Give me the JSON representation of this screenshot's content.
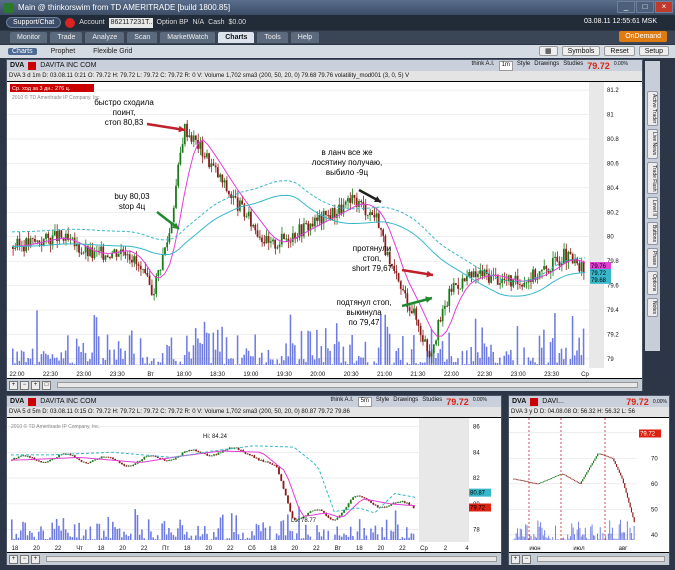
{
  "window": {
    "title": "Main @ thinkorswim from TD AMERITRADE [build 1800.85]"
  },
  "account": {
    "support_label": "Support/Chat",
    "account_label": "Account",
    "account_value": "862117231T...",
    "option_bp_label": "Option BP",
    "option_bp_value": "N/A",
    "cash_label": "Cash",
    "cash_value": "$0.00",
    "datetime": "03.08.11 12:55:61 MSK"
  },
  "tabs": [
    "Monitor",
    "Trade",
    "Analyze",
    "Scan",
    "MarketWatch",
    "Charts",
    "Tools",
    "Help"
  ],
  "active_tab": "Charts",
  "ondemand": "OnDemand",
  "subtabs": [
    "Charts",
    "Prophet",
    "Flexible Grid"
  ],
  "toolbar": {
    "symbols": "Symbols",
    "reset": "Reset",
    "setup": "Setup"
  },
  "main_chart": {
    "symbol": "DVA",
    "company": "DAVITA INC COM",
    "think": "think A.I.",
    "period": "1m",
    "style": "Style",
    "drawings": "Drawings",
    "studies": "Studies",
    "last": "79.72",
    "pct": "0.00%",
    "quote": "DVA 3 d 1m  D: 03.08.11 0:21  O: 79.72  H: 79.72  L: 79.72  C: 79.72  R: 0  V:  Volume 1,702  sma3 (200, 50, 20, 0)  79.68  79.76  volatility_mod001 (3, 0, 5)  V",
    "note_red": "Ср. ход за 3 дн.: 276 ц.",
    "copyright": "2010 © TD Ameritrade IP Company, Inc.",
    "y_ticks": [
      "81.2",
      "81",
      "80.8",
      "80.6",
      "80.4",
      "80.2",
      "80",
      "79.8",
      "79.6",
      "79.4",
      "79.2",
      "79"
    ],
    "x_ticks": [
      "22:00",
      "22:30",
      "23:00",
      "23:30",
      "Вт",
      "18:00",
      "18:30",
      "19:00",
      "19:30",
      "20:00",
      "20:30",
      "21:00",
      "21:30",
      "22:00",
      "22:30",
      "23:00",
      "23:30",
      "Ср"
    ],
    "price_labels": [
      "79.76",
      "79.72",
      "79.68"
    ],
    "annotations": {
      "a1": [
        "быстро сходила",
        "поинт,",
        "стоп 80,83"
      ],
      "a2": [
        "buy 80,03",
        "stop 4ц"
      ],
      "a3": [
        "в ланч все же",
        "лосятину получаю,",
        "выбило -9ц"
      ],
      "a4": [
        "протянули",
        "стоп,",
        "short 79,67"
      ],
      "a5": [
        "подтянул стоп,",
        "выкинула",
        "по 79,47"
      ]
    }
  },
  "side_tabs": [
    "Active Trader",
    "Live News",
    "Trade Flash",
    "Level II",
    "Buttons",
    "Phase",
    "Options",
    "Notes"
  ],
  "chart2": {
    "symbol": "DVA",
    "company": "DAVITA INC COM",
    "think": "think A.I.",
    "period": "5m",
    "style": "Style",
    "drawings": "Drawings",
    "studies": "Studies",
    "last": "79.72",
    "pct": "0.00%",
    "quote": "DVA 5 d 5m  D: 03.08.11 0:15  O: 79.72  H: 79.72  L: 79.72  C: 79.72  R: 0  V:  Volume 1,702  sma3 (200, 50, 20, 0)  80.87  79.72  79.86",
    "copyright": "2010 © TD Ameritrade IP Company, Inc.",
    "hi": "Hi: 84.24",
    "lo": "Lo: 78.77",
    "y_ticks": [
      "86",
      "84",
      "82",
      "80",
      "78"
    ],
    "x_ticks": [
      "18",
      "20",
      "22",
      "Чт",
      "18",
      "20",
      "22",
      "Пт",
      "18",
      "20",
      "22",
      "Сб",
      "18",
      "20",
      "22",
      "Вт",
      "18",
      "20",
      "22",
      "Ср",
      "2",
      "4"
    ],
    "price_labels": [
      "80.87",
      "79.72"
    ]
  },
  "chart3": {
    "symbol": "DVA",
    "company": "DAVI...",
    "last": "79.72",
    "pct": "0.00%",
    "quote": "DVA 3 y D  D: 04.08.08  O: 56.32  H: 56.32  L: 56",
    "y_ticks": [
      "80",
      "70",
      "60",
      "50",
      "40"
    ],
    "x_ticks": [
      "июн",
      "июл",
      "авг"
    ],
    "price_labels": [
      "79.72"
    ],
    "side_labels": [
      "Active Trader",
      "Live News",
      "Level II"
    ]
  }
}
